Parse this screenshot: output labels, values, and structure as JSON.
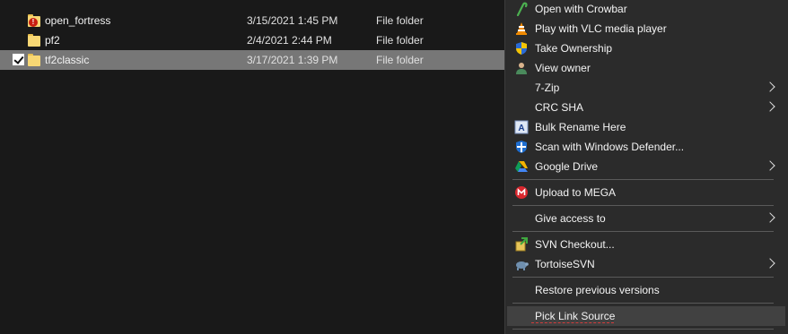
{
  "files": [
    {
      "name": "open_fortress",
      "date": "3/15/2021 1:45 PM",
      "type": "File folder",
      "icon": "folder-badge-icon",
      "selected": false
    },
    {
      "name": "pf2",
      "date": "2/4/2021 2:44 PM",
      "type": "File folder",
      "icon": "folder-icon",
      "selected": false
    },
    {
      "name": "tf2classic",
      "date": "3/17/2021 1:39 PM",
      "type": "File folder",
      "icon": "folder-icon",
      "selected": true
    }
  ],
  "menu": {
    "items": [
      {
        "label": "Open with Crowbar",
        "icon": "crowbar-icon"
      },
      {
        "label": "Play with VLC media player",
        "icon": "vlc-cone-icon"
      },
      {
        "label": "Take Ownership",
        "icon": "uac-shield-icon"
      },
      {
        "label": "View owner",
        "icon": "user-icon"
      },
      {
        "label": "7-Zip",
        "icon": "none",
        "submenu": true
      },
      {
        "label": "CRC SHA",
        "icon": "none",
        "submenu": true
      },
      {
        "label": "Bulk Rename Here",
        "icon": "bulk-rename-icon"
      },
      {
        "label": "Scan with Windows Defender...",
        "icon": "defender-icon"
      },
      {
        "label": "Google Drive",
        "icon": "google-drive-icon",
        "submenu": true
      },
      {
        "label": "Upload to MEGA",
        "icon": "mega-icon"
      },
      {
        "label": "Give access to",
        "icon": "none",
        "submenu": true
      },
      {
        "label": "SVN Checkout...",
        "icon": "svn-checkout-icon"
      },
      {
        "label": "TortoiseSVN",
        "icon": "tortoisesvn-icon",
        "submenu": true
      },
      {
        "label": "Restore previous versions",
        "icon": "none"
      },
      {
        "label": "Pick Link Source",
        "icon": "none",
        "hovered": true
      }
    ]
  },
  "colors": {
    "background": "#191919",
    "menu_background": "#2b2b2b",
    "selection": "#777777",
    "hover": "#414141",
    "folder": "#f7d774"
  }
}
